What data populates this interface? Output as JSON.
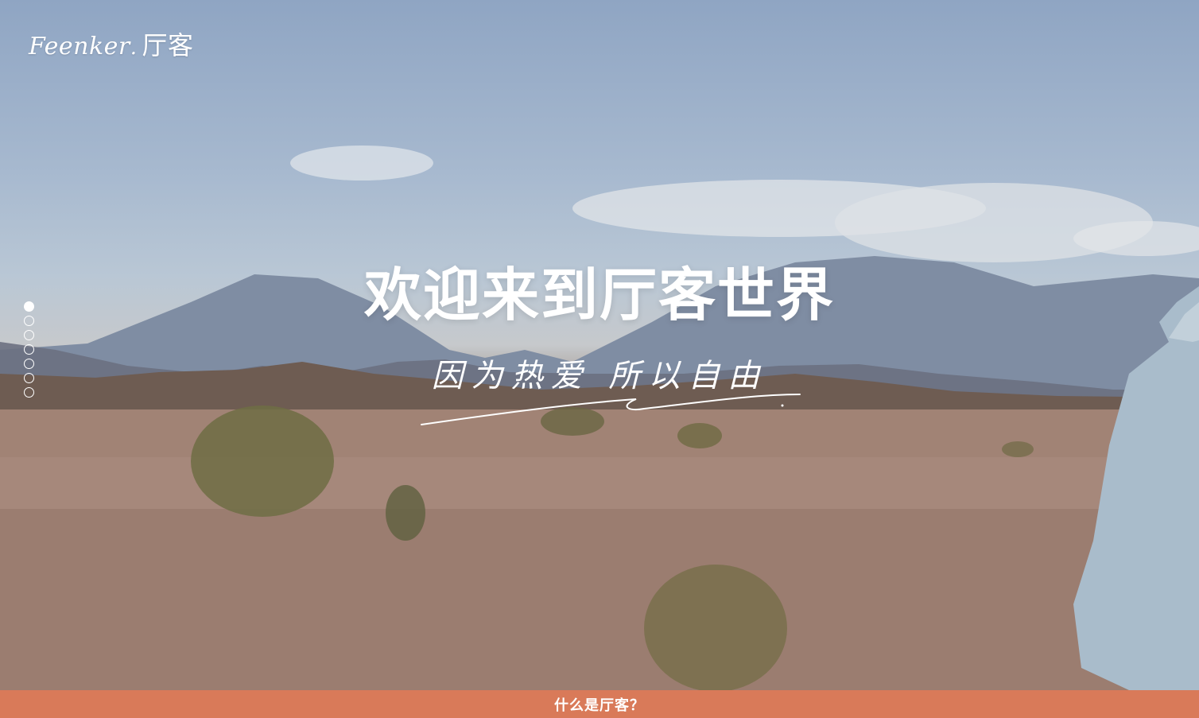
{
  "header": {
    "logo_latin": "Feenker",
    "logo_dot": ".",
    "logo_chinese": "厅客"
  },
  "pager": {
    "count": 7,
    "active_index": 0
  },
  "hero": {
    "headline": "欢迎来到厅客世界",
    "tagline": "因为热爱 所以自由"
  },
  "footer_bar": {
    "label": "什么是厅客？",
    "color": "#d97a59"
  }
}
